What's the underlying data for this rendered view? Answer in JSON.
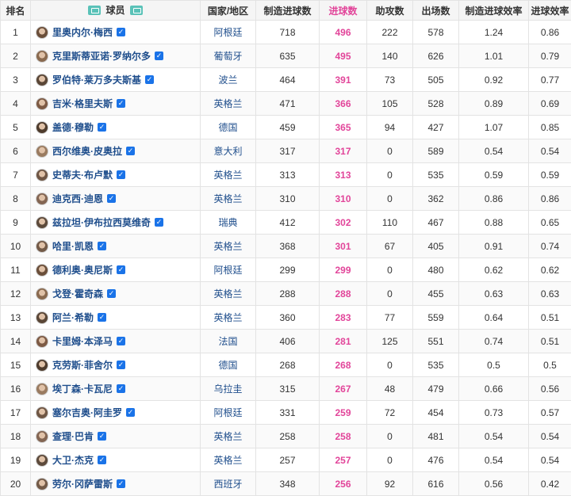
{
  "headers": {
    "rank": "排名",
    "player": "球员",
    "country": "国家/地区",
    "contrib": "制造进球数",
    "goals": "进球数",
    "assists": "助攻数",
    "apps": "出场数",
    "contrib_eff": "制造进球效率",
    "goal_eff": "进球效率"
  },
  "icons": {
    "header_left": "table-icon",
    "header_right": "table-icon",
    "verified": "check-icon",
    "avatar": "player-avatar"
  },
  "colors": {
    "player_name": "#1f4e8c",
    "goals": "#e2459a",
    "verified": "#1a73e8",
    "header_icon": "#5ac2b8"
  },
  "rows": [
    {
      "rank": "1",
      "name": "里奥内尔·梅西",
      "country": "阿根廷",
      "contrib": "718",
      "goals": "496",
      "assists": "222",
      "apps": "578",
      "contrib_eff": "1.24",
      "goal_eff": "0.86"
    },
    {
      "rank": "2",
      "name": "克里斯蒂亚诺·罗纳尔多",
      "country": "葡萄牙",
      "contrib": "635",
      "goals": "495",
      "assists": "140",
      "apps": "626",
      "contrib_eff": "1.01",
      "goal_eff": "0.79"
    },
    {
      "rank": "3",
      "name": "罗伯特·莱万多夫斯基",
      "country": "波兰",
      "contrib": "464",
      "goals": "391",
      "assists": "73",
      "apps": "505",
      "contrib_eff": "0.92",
      "goal_eff": "0.77"
    },
    {
      "rank": "4",
      "name": "吉米·格里夫斯",
      "country": "英格兰",
      "contrib": "471",
      "goals": "366",
      "assists": "105",
      "apps": "528",
      "contrib_eff": "0.89",
      "goal_eff": "0.69"
    },
    {
      "rank": "5",
      "name": "盖德·穆勒",
      "country": "德国",
      "contrib": "459",
      "goals": "365",
      "assists": "94",
      "apps": "427",
      "contrib_eff": "1.07",
      "goal_eff": "0.85"
    },
    {
      "rank": "6",
      "name": "西尔维奥·皮奥拉",
      "country": "意大利",
      "contrib": "317",
      "goals": "317",
      "assists": "0",
      "apps": "589",
      "contrib_eff": "0.54",
      "goal_eff": "0.54"
    },
    {
      "rank": "7",
      "name": "史蒂夫·布卢默",
      "country": "英格兰",
      "contrib": "313",
      "goals": "313",
      "assists": "0",
      "apps": "535",
      "contrib_eff": "0.59",
      "goal_eff": "0.59"
    },
    {
      "rank": "8",
      "name": "迪克西·迪恩",
      "country": "英格兰",
      "contrib": "310",
      "goals": "310",
      "assists": "0",
      "apps": "362",
      "contrib_eff": "0.86",
      "goal_eff": "0.86"
    },
    {
      "rank": "9",
      "name": "兹拉坦·伊布拉西莫维奇",
      "country": "瑞典",
      "contrib": "412",
      "goals": "302",
      "assists": "110",
      "apps": "467",
      "contrib_eff": "0.88",
      "goal_eff": "0.65"
    },
    {
      "rank": "10",
      "name": "哈里·凯恩",
      "country": "英格兰",
      "contrib": "368",
      "goals": "301",
      "assists": "67",
      "apps": "405",
      "contrib_eff": "0.91",
      "goal_eff": "0.74"
    },
    {
      "rank": "11",
      "name": "德利奥·奥尼斯",
      "country": "阿根廷",
      "contrib": "299",
      "goals": "299",
      "assists": "0",
      "apps": "480",
      "contrib_eff": "0.62",
      "goal_eff": "0.62"
    },
    {
      "rank": "12",
      "name": "戈登·霍奇森",
      "country": "英格兰",
      "contrib": "288",
      "goals": "288",
      "assists": "0",
      "apps": "455",
      "contrib_eff": "0.63",
      "goal_eff": "0.63"
    },
    {
      "rank": "13",
      "name": "阿兰·希勒",
      "country": "英格兰",
      "contrib": "360",
      "goals": "283",
      "assists": "77",
      "apps": "559",
      "contrib_eff": "0.64",
      "goal_eff": "0.51"
    },
    {
      "rank": "14",
      "name": "卡里姆·本泽马",
      "country": "法国",
      "contrib": "406",
      "goals": "281",
      "assists": "125",
      "apps": "551",
      "contrib_eff": "0.74",
      "goal_eff": "0.51"
    },
    {
      "rank": "15",
      "name": "克劳斯·菲舍尔",
      "country": "德国",
      "contrib": "268",
      "goals": "268",
      "assists": "0",
      "apps": "535",
      "contrib_eff": "0.5",
      "goal_eff": "0.5"
    },
    {
      "rank": "16",
      "name": "埃丁森·卡瓦尼",
      "country": "乌拉圭",
      "contrib": "315",
      "goals": "267",
      "assists": "48",
      "apps": "479",
      "contrib_eff": "0.66",
      "goal_eff": "0.56"
    },
    {
      "rank": "17",
      "name": "塞尔吉奥·阿圭罗",
      "country": "阿根廷",
      "contrib": "331",
      "goals": "259",
      "assists": "72",
      "apps": "454",
      "contrib_eff": "0.73",
      "goal_eff": "0.57"
    },
    {
      "rank": "18",
      "name": "查理·巴肯",
      "country": "英格兰",
      "contrib": "258",
      "goals": "258",
      "assists": "0",
      "apps": "481",
      "contrib_eff": "0.54",
      "goal_eff": "0.54"
    },
    {
      "rank": "19",
      "name": "大卫·杰克",
      "country": "英格兰",
      "contrib": "257",
      "goals": "257",
      "assists": "0",
      "apps": "476",
      "contrib_eff": "0.54",
      "goal_eff": "0.54"
    },
    {
      "rank": "20",
      "name": "劳尔·冈萨雷斯",
      "country": "西班牙",
      "contrib": "348",
      "goals": "256",
      "assists": "92",
      "apps": "616",
      "contrib_eff": "0.56",
      "goal_eff": "0.42"
    }
  ]
}
